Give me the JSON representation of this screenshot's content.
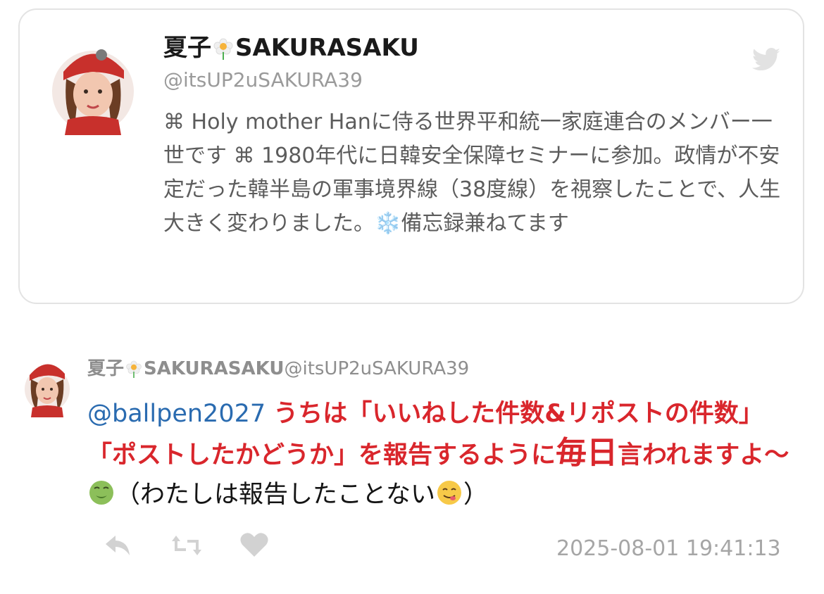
{
  "profile": {
    "name_prefix": "夏子",
    "name_suffix": "SAKURASAKU",
    "handle": "@itsUP2uSAKURA39",
    "bio_part1": "⌘ Holy mother Hanに侍る世界平和統一家庭連合のメンバー一世です ⌘ 1980年代に日韓安全保障セミナーに参加。政情が不安定だった韓半島の軍事境界線（38度線）を視察したことで、人生大きく変わりました。",
    "bio_snowflake": "❄️",
    "bio_part2": "備忘録兼ねてます"
  },
  "post": {
    "author_prefix": "夏子",
    "author_suffix": "SAKURASAKU",
    "author_handle": "@itsUP2uSAKURA39",
    "mention": "@ballpen2027",
    "text_red1": "うちは「いいねした件数&リポストの件数」「ポストしたかどうか」を報告するように",
    "text_red_big": "毎日",
    "text_red2": "言われますよ〜",
    "text_plain": "（わたしは報告したことない",
    "text_close": "）",
    "timestamp": "2025-08-01 19:41:13"
  },
  "icons": {
    "flower": "flower-icon",
    "bird": "twitter-bird-icon",
    "reply": "reply-icon",
    "retweet": "retweet-icon",
    "like": "heart-icon",
    "nauseated": "nauseated-face-emoji",
    "yum": "yum-face-emoji"
  },
  "colors": {
    "mention": "#2a6bb0",
    "emphasis_red": "#d9262c",
    "bio_gray": "#5c5c5c",
    "meta_gray": "#a6a6a6"
  }
}
